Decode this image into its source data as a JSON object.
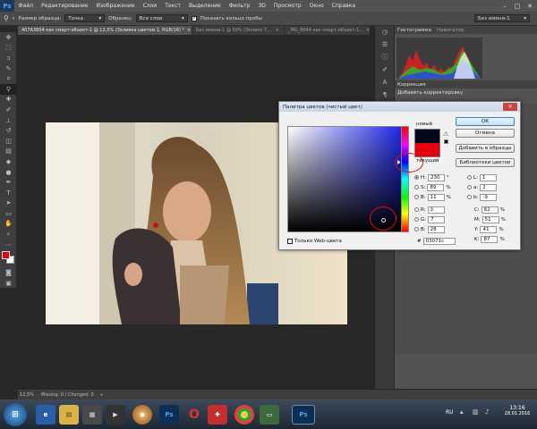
{
  "app": {
    "logo": "Ps"
  },
  "menu": [
    "Файл",
    "Редактирование",
    "Изображение",
    "Слои",
    "Текст",
    "Выделение",
    "Фильтр",
    "3D",
    "Просмотр",
    "Окно",
    "Справка"
  ],
  "options": {
    "sample_size_label": "Размер образца:",
    "sample_size_value": "Точка",
    "sample_label": "Образец:",
    "sample_value": "Все слои",
    "show_ring_label": "Показать кольцо пробы",
    "workspace_value": "Без имени-1"
  },
  "tabs": [
    "407А3804 как смарт-объект-1 @ 12,5% (Заливка цветом 1, RGB/16) *",
    "Без имени-1 @ 50% (Эллипс 7,...",
    "_MG_8644 как смарт-объект-1..."
  ],
  "panels": {
    "histogram_tab": "Гистограмма",
    "navigator_tab": "Навигатор",
    "corrections_tab": "Коррекция",
    "add_correction": "Добавить корректировку"
  },
  "picker": {
    "title": "Палитра цветов (чистый цвет)",
    "new_label": "новый",
    "current_label": "текущий",
    "ok": "ОК",
    "cancel": "Отмена",
    "add_to_swatches": "Добавить в образцы",
    "color_libraries": "Библиотеки цветов",
    "web_only": "Только Web-цвета",
    "hex_prefix": "#",
    "hex": "03071c",
    "new_color": "#03071c",
    "current_color": "#e4000f",
    "hsb": [
      {
        "label": "H:",
        "value": "230",
        "unit": "°",
        "selected": true
      },
      {
        "label": "S:",
        "value": "89",
        "unit": "%",
        "selected": false
      },
      {
        "label": "B:",
        "value": "11",
        "unit": "%",
        "selected": false
      }
    ],
    "rgb": [
      {
        "label": "R:",
        "value": "3"
      },
      {
        "label": "G:",
        "value": "7"
      },
      {
        "label": "B:",
        "value": "28"
      }
    ],
    "lab": [
      {
        "label": "L:",
        "value": "1"
      },
      {
        "label": "a:",
        "value": "2"
      },
      {
        "label": "b:",
        "value": "-9"
      }
    ],
    "cmyk": [
      {
        "label": "C:",
        "value": "62",
        "unit": "%"
      },
      {
        "label": "M:",
        "value": "51",
        "unit": "%"
      },
      {
        "label": "Y:",
        "value": "41",
        "unit": "%"
      },
      {
        "label": "K:",
        "value": "87",
        "unit": "%"
      }
    ]
  },
  "status": {
    "zoom": "12,5%",
    "info": "Missing: 0 / Changed: 0"
  },
  "taskbar": {
    "lang": "RU",
    "time": "13:16",
    "date": "28.01.2016"
  },
  "colors": {
    "foreground": "#e4000f",
    "background": "#ffffff"
  }
}
